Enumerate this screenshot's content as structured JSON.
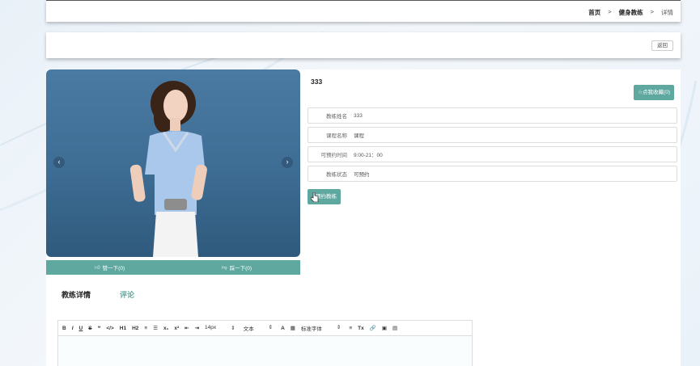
{
  "breadcrumb": {
    "home": "首页",
    "sep": ">",
    "section": "健身教练",
    "current": "详情"
  },
  "back_button": "返回",
  "carousel": {
    "prev": "‹",
    "next": "›"
  },
  "votes": {
    "like": "赞一下(0)",
    "dislike": "踩一下(0)"
  },
  "detail": {
    "title": "333",
    "favorite_button": "☆点我收藏(0)",
    "fields": [
      {
        "label": "教练姓名",
        "value": "333"
      },
      {
        "label": "课程名称",
        "value": "课程"
      },
      {
        "label": "可预约时间",
        "value": "9:00-21：00"
      },
      {
        "label": "教练状态",
        "value": "可预约"
      }
    ],
    "book_button": "预约教练"
  },
  "tabs": [
    {
      "label": "教练详情"
    },
    {
      "label": "评论"
    }
  ],
  "editor": {
    "toolbar": {
      "bold": "B",
      "italic": "I",
      "underline": "U",
      "strike": "S",
      "quote": "❝",
      "code": "</>",
      "h1": "H1",
      "h2": "H2",
      "ol": "≡",
      "ul": "☰",
      "sub": "x₁",
      "sup": "x²",
      "outdent": "⇤",
      "indent": "⇥",
      "size": "14px",
      "format": "文本",
      "font": "标准字体",
      "color": "A",
      "align": "≡",
      "clean": "Tx",
      "link": "🔗",
      "image": "▣",
      "video": "▤"
    }
  },
  "colors": {
    "accent": "#5fa8a0",
    "carousel_bg": "#4a7aa2"
  }
}
